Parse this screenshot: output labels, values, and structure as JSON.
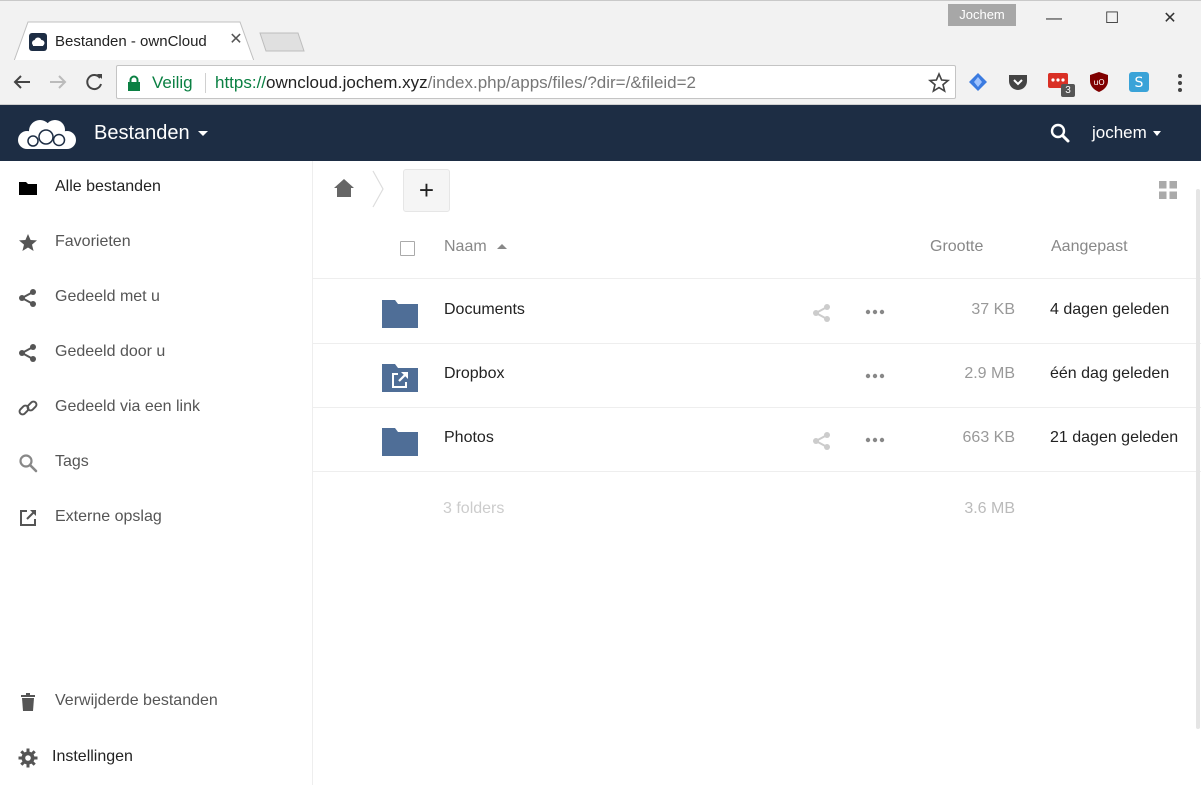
{
  "browser": {
    "tab_title": "Bestanden - ownCloud",
    "profile_name": "Jochem",
    "secure_label": "Veilig",
    "url_scheme": "https://",
    "url_host": "owncloud.jochem.xyz",
    "url_path": "/index.php/apps/files/?dir=/&fileid=2",
    "extension_badge": "3"
  },
  "header": {
    "app_name": "Bestanden",
    "username": "jochem"
  },
  "sidebar": {
    "items": [
      {
        "label": "Alle bestanden",
        "icon": "folder-icon",
        "active": true
      },
      {
        "label": "Favorieten",
        "icon": "star-icon"
      },
      {
        "label": "Gedeeld met u",
        "icon": "share-icon"
      },
      {
        "label": "Gedeeld door u",
        "icon": "share-icon"
      },
      {
        "label": "Gedeeld via een link",
        "icon": "link-icon"
      },
      {
        "label": "Tags",
        "icon": "search-icon"
      },
      {
        "label": "Externe opslag",
        "icon": "external-link-icon"
      }
    ],
    "bottom": [
      {
        "label": "Verwijderde bestanden",
        "icon": "trash-icon"
      },
      {
        "label": "Instellingen",
        "icon": "gear-icon"
      }
    ]
  },
  "files": {
    "new_button_label": "+",
    "columns": {
      "name": "Naam",
      "size": "Grootte",
      "modified": "Aangepast"
    },
    "rows": [
      {
        "name": "Documents",
        "size": "37 KB",
        "modified": "4 dagen geleden",
        "type": "folder",
        "shared": true
      },
      {
        "name": "Dropbox",
        "size": "2.9 MB",
        "modified": "één dag geleden",
        "type": "external-folder",
        "shared": false
      },
      {
        "name": "Photos",
        "size": "663 KB",
        "modified": "21 dagen geleden",
        "type": "folder",
        "shared": true
      }
    ],
    "summary": {
      "count": "3 folders",
      "size": "3.6 MB"
    }
  },
  "colors": {
    "header_bg": "#1d2d44",
    "folder": "#4f6e97",
    "secure": "#0b8043"
  }
}
